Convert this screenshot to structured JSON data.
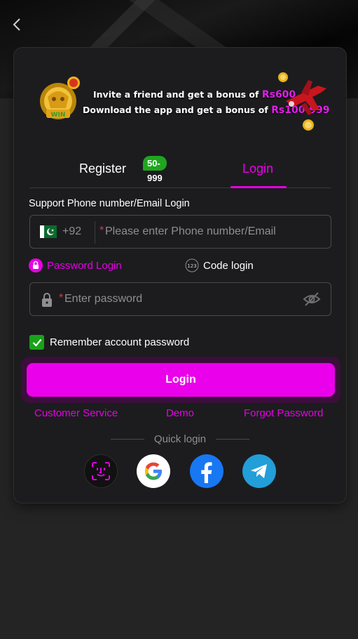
{
  "nav": {
    "back_icon": "chevron-left-icon"
  },
  "banner": {
    "line1_text": "Invite a friend and get a bonus of ",
    "line1_amount": "Rs600",
    "line2_text": "Download the app and get a bonus of ",
    "line2_amount": "Rs100-999",
    "emblem_text": "WIN",
    "accent_color": "#e01ee8"
  },
  "tabs": {
    "register_label": "Register",
    "register_badge": "50-999",
    "login_label": "Login",
    "active": "login"
  },
  "form": {
    "support_label": "Support Phone number/Email Login",
    "country_code": "+92",
    "phone_required_mark": "*",
    "phone_placeholder": "Please enter Phone number/Email",
    "phone_value": "",
    "password_login_label": "Password Login",
    "code_login_label": "Code login",
    "code_icon_text": "123",
    "password_required_mark": "*",
    "password_placeholder": "Enter password",
    "password_value": "",
    "remember_label": "Remember account password",
    "remember_checked": true,
    "login_button": "Login"
  },
  "links": {
    "customer_service": "Customer Service",
    "demo": "Demo",
    "forgot_password": "Forgot Password"
  },
  "quick_login": {
    "label": "Quick login",
    "providers": [
      "face-id-icon",
      "google-icon",
      "facebook-icon",
      "telegram-icon"
    ]
  },
  "colors": {
    "accent": "#ea00ea",
    "success": "#19a319",
    "background": "#242424",
    "card": "#1c1c1e"
  }
}
